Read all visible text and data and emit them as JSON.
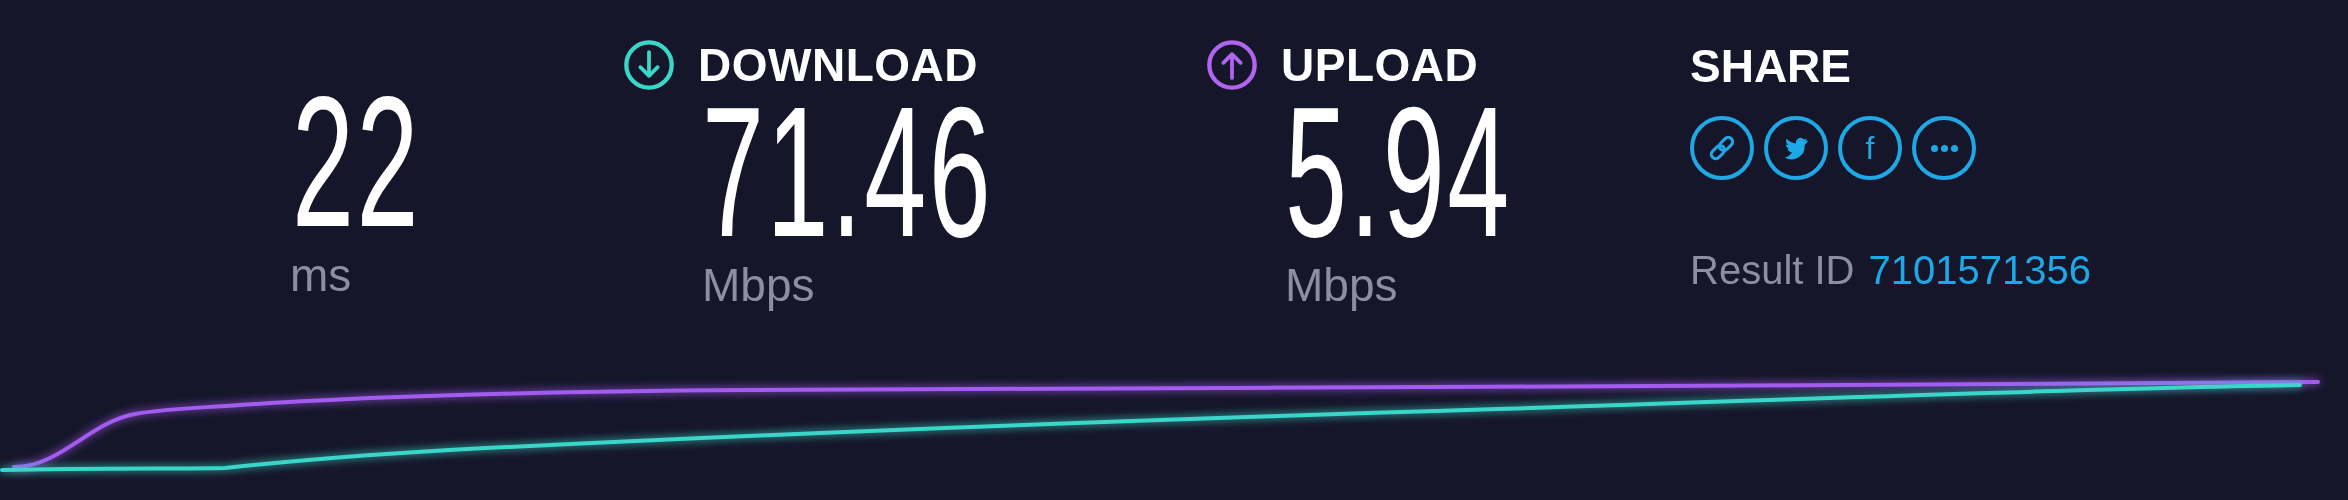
{
  "metrics": [
    {
      "kind": "ping",
      "value": "22",
      "unit": "ms"
    },
    {
      "kind": "download",
      "label": "DOWNLOAD",
      "value": "71.46",
      "unit": "Mbps"
    },
    {
      "kind": "upload",
      "label": "UPLOAD",
      "value": "5.94",
      "unit": "Mbps"
    }
  ],
  "share": {
    "title": "SHARE",
    "buttons": [
      {
        "kind": "link"
      },
      {
        "kind": "twitter"
      },
      {
        "kind": "facebook",
        "glyph": "f"
      },
      {
        "kind": "more"
      }
    ],
    "result_label": "Result ID",
    "result_id": "7101571356"
  }
}
